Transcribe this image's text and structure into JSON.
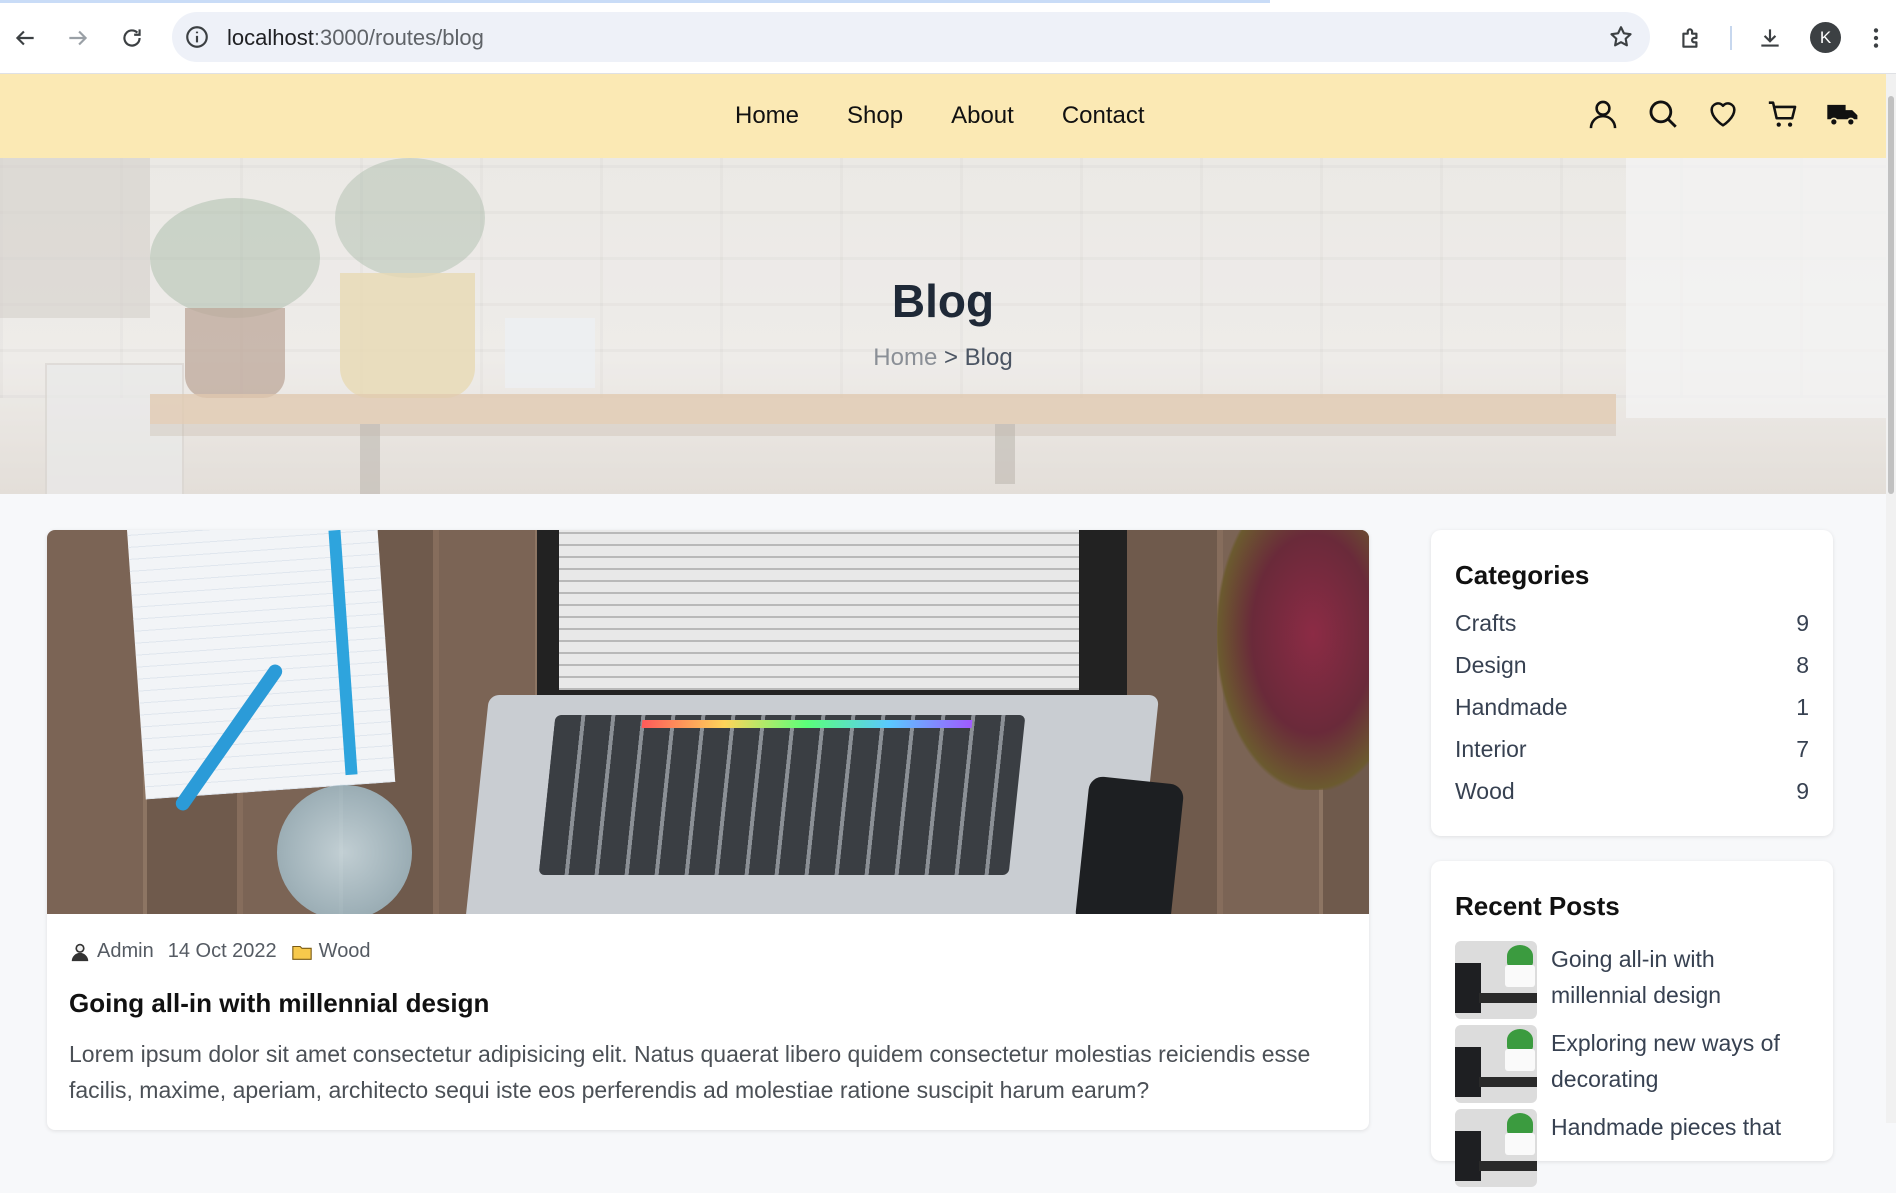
{
  "browser": {
    "url_host": "localhost",
    "url_rest": ":3000/routes/blog",
    "profile_initial": "K"
  },
  "nav": {
    "links": [
      "Home",
      "Shop",
      "About",
      "Contact"
    ],
    "accent_color": "#fbe9b4"
  },
  "hero": {
    "title": "Blog",
    "breadcrumb_home": "Home",
    "breadcrumb_sep": ">",
    "breadcrumb_current": "Blog"
  },
  "post": {
    "author": "Admin",
    "date": "14 Oct 2022",
    "category": "Wood",
    "title": "Going all-in with millennial design",
    "excerpt": "Lorem ipsum dolor sit amet consectetur adipisicing elit. Natus quaerat libero quidem consectetur molestias reiciendis esse facilis, maxime, aperiam, architecto sequi iste eos perferendis ad molestiae ratione suscipit harum earum?"
  },
  "sidebar": {
    "categories_title": "Categories",
    "categories": [
      {
        "name": "Crafts",
        "count": "9"
      },
      {
        "name": "Design",
        "count": "8"
      },
      {
        "name": "Handmade",
        "count": "1"
      },
      {
        "name": "Interior",
        "count": "7"
      },
      {
        "name": "Wood",
        "count": "9"
      }
    ],
    "recent_title": "Recent Posts",
    "recent_posts": [
      {
        "title": "Going all-in with millennial design"
      },
      {
        "title": "Exploring new ways of decorating"
      },
      {
        "title": "Handmade pieces that"
      }
    ]
  },
  "icons": {
    "nav": [
      "user-icon",
      "search-icon",
      "heart-icon",
      "cart-icon",
      "truck-icon"
    ],
    "browser": [
      "back-icon",
      "forward-icon",
      "reload-icon",
      "info-icon",
      "star-icon",
      "extensions-icon",
      "download-icon",
      "menu-icon"
    ]
  }
}
